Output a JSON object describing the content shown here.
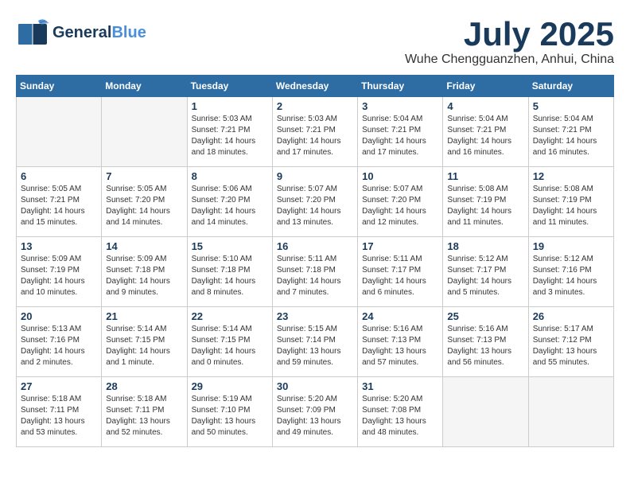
{
  "header": {
    "logo_general": "General",
    "logo_blue": "Blue",
    "month_title": "July 2025",
    "location": "Wuhe Chengguanzhen, Anhui, China"
  },
  "weekdays": [
    "Sunday",
    "Monday",
    "Tuesday",
    "Wednesday",
    "Thursday",
    "Friday",
    "Saturday"
  ],
  "weeks": [
    [
      {
        "day": "",
        "empty": true
      },
      {
        "day": "",
        "empty": true
      },
      {
        "day": "1",
        "sunrise": "Sunrise: 5:03 AM",
        "sunset": "Sunset: 7:21 PM",
        "daylight": "Daylight: 14 hours and 18 minutes."
      },
      {
        "day": "2",
        "sunrise": "Sunrise: 5:03 AM",
        "sunset": "Sunset: 7:21 PM",
        "daylight": "Daylight: 14 hours and 17 minutes."
      },
      {
        "day": "3",
        "sunrise": "Sunrise: 5:04 AM",
        "sunset": "Sunset: 7:21 PM",
        "daylight": "Daylight: 14 hours and 17 minutes."
      },
      {
        "day": "4",
        "sunrise": "Sunrise: 5:04 AM",
        "sunset": "Sunset: 7:21 PM",
        "daylight": "Daylight: 14 hours and 16 minutes."
      },
      {
        "day": "5",
        "sunrise": "Sunrise: 5:04 AM",
        "sunset": "Sunset: 7:21 PM",
        "daylight": "Daylight: 14 hours and 16 minutes."
      }
    ],
    [
      {
        "day": "6",
        "sunrise": "Sunrise: 5:05 AM",
        "sunset": "Sunset: 7:21 PM",
        "daylight": "Daylight: 14 hours and 15 minutes."
      },
      {
        "day": "7",
        "sunrise": "Sunrise: 5:05 AM",
        "sunset": "Sunset: 7:20 PM",
        "daylight": "Daylight: 14 hours and 14 minutes."
      },
      {
        "day": "8",
        "sunrise": "Sunrise: 5:06 AM",
        "sunset": "Sunset: 7:20 PM",
        "daylight": "Daylight: 14 hours and 14 minutes."
      },
      {
        "day": "9",
        "sunrise": "Sunrise: 5:07 AM",
        "sunset": "Sunset: 7:20 PM",
        "daylight": "Daylight: 14 hours and 13 minutes."
      },
      {
        "day": "10",
        "sunrise": "Sunrise: 5:07 AM",
        "sunset": "Sunset: 7:20 PM",
        "daylight": "Daylight: 14 hours and 12 minutes."
      },
      {
        "day": "11",
        "sunrise": "Sunrise: 5:08 AM",
        "sunset": "Sunset: 7:19 PM",
        "daylight": "Daylight: 14 hours and 11 minutes."
      },
      {
        "day": "12",
        "sunrise": "Sunrise: 5:08 AM",
        "sunset": "Sunset: 7:19 PM",
        "daylight": "Daylight: 14 hours and 11 minutes."
      }
    ],
    [
      {
        "day": "13",
        "sunrise": "Sunrise: 5:09 AM",
        "sunset": "Sunset: 7:19 PM",
        "daylight": "Daylight: 14 hours and 10 minutes."
      },
      {
        "day": "14",
        "sunrise": "Sunrise: 5:09 AM",
        "sunset": "Sunset: 7:18 PM",
        "daylight": "Daylight: 14 hours and 9 minutes."
      },
      {
        "day": "15",
        "sunrise": "Sunrise: 5:10 AM",
        "sunset": "Sunset: 7:18 PM",
        "daylight": "Daylight: 14 hours and 8 minutes."
      },
      {
        "day": "16",
        "sunrise": "Sunrise: 5:11 AM",
        "sunset": "Sunset: 7:18 PM",
        "daylight": "Daylight: 14 hours and 7 minutes."
      },
      {
        "day": "17",
        "sunrise": "Sunrise: 5:11 AM",
        "sunset": "Sunset: 7:17 PM",
        "daylight": "Daylight: 14 hours and 6 minutes."
      },
      {
        "day": "18",
        "sunrise": "Sunrise: 5:12 AM",
        "sunset": "Sunset: 7:17 PM",
        "daylight": "Daylight: 14 hours and 5 minutes."
      },
      {
        "day": "19",
        "sunrise": "Sunrise: 5:12 AM",
        "sunset": "Sunset: 7:16 PM",
        "daylight": "Daylight: 14 hours and 3 minutes."
      }
    ],
    [
      {
        "day": "20",
        "sunrise": "Sunrise: 5:13 AM",
        "sunset": "Sunset: 7:16 PM",
        "daylight": "Daylight: 14 hours and 2 minutes."
      },
      {
        "day": "21",
        "sunrise": "Sunrise: 5:14 AM",
        "sunset": "Sunset: 7:15 PM",
        "daylight": "Daylight: 14 hours and 1 minute."
      },
      {
        "day": "22",
        "sunrise": "Sunrise: 5:14 AM",
        "sunset": "Sunset: 7:15 PM",
        "daylight": "Daylight: 14 hours and 0 minutes."
      },
      {
        "day": "23",
        "sunrise": "Sunrise: 5:15 AM",
        "sunset": "Sunset: 7:14 PM",
        "daylight": "Daylight: 13 hours and 59 minutes."
      },
      {
        "day": "24",
        "sunrise": "Sunrise: 5:16 AM",
        "sunset": "Sunset: 7:13 PM",
        "daylight": "Daylight: 13 hours and 57 minutes."
      },
      {
        "day": "25",
        "sunrise": "Sunrise: 5:16 AM",
        "sunset": "Sunset: 7:13 PM",
        "daylight": "Daylight: 13 hours and 56 minutes."
      },
      {
        "day": "26",
        "sunrise": "Sunrise: 5:17 AM",
        "sunset": "Sunset: 7:12 PM",
        "daylight": "Daylight: 13 hours and 55 minutes."
      }
    ],
    [
      {
        "day": "27",
        "sunrise": "Sunrise: 5:18 AM",
        "sunset": "Sunset: 7:11 PM",
        "daylight": "Daylight: 13 hours and 53 minutes."
      },
      {
        "day": "28",
        "sunrise": "Sunrise: 5:18 AM",
        "sunset": "Sunset: 7:11 PM",
        "daylight": "Daylight: 13 hours and 52 minutes."
      },
      {
        "day": "29",
        "sunrise": "Sunrise: 5:19 AM",
        "sunset": "Sunset: 7:10 PM",
        "daylight": "Daylight: 13 hours and 50 minutes."
      },
      {
        "day": "30",
        "sunrise": "Sunrise: 5:20 AM",
        "sunset": "Sunset: 7:09 PM",
        "daylight": "Daylight: 13 hours and 49 minutes."
      },
      {
        "day": "31",
        "sunrise": "Sunrise: 5:20 AM",
        "sunset": "Sunset: 7:08 PM",
        "daylight": "Daylight: 13 hours and 48 minutes."
      },
      {
        "day": "",
        "empty": true
      },
      {
        "day": "",
        "empty": true
      }
    ]
  ]
}
